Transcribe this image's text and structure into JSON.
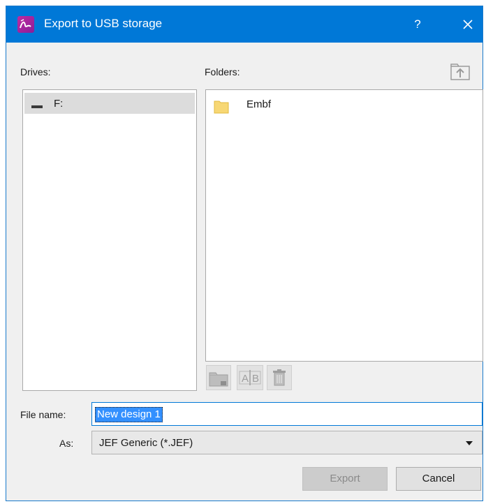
{
  "window": {
    "title": "Export to USB storage",
    "help_label": "?",
    "accent_color": "#0078d7"
  },
  "drives": {
    "label": "Drives:",
    "items": [
      {
        "label": "F:",
        "icon": "usb-drive-icon",
        "selected": true
      }
    ]
  },
  "folders": {
    "label": "Folders:",
    "items": [
      {
        "label": "Embf",
        "icon": "folder-icon"
      }
    ],
    "toolbar": {
      "up_icon": "folder-up-icon",
      "new_icon": "new-folder-icon",
      "rename_icon": "rename-icon",
      "rename_text": "A|B",
      "delete_icon": "trash-icon"
    }
  },
  "file_name": {
    "label": "File name:",
    "value": "New design 1"
  },
  "as": {
    "label": "As:",
    "value": "JEF Generic (*.JEF)"
  },
  "buttons": {
    "export": "Export",
    "cancel": "Cancel"
  }
}
